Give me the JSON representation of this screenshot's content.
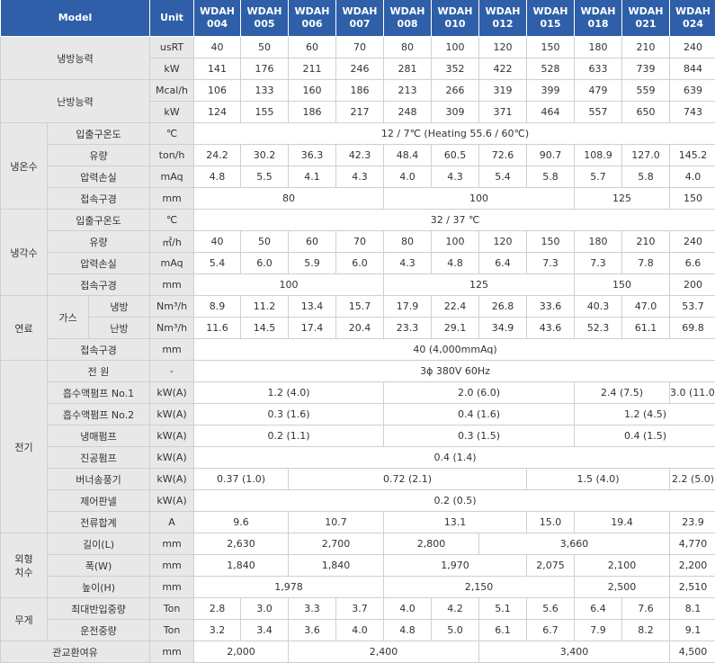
{
  "header": {
    "model": "Model",
    "unit": "Unit",
    "models": [
      {
        "name": "WDAH",
        "num": "004"
      },
      {
        "name": "WDAH",
        "num": "005"
      },
      {
        "name": "WDAH",
        "num": "006"
      },
      {
        "name": "WDAH",
        "num": "007"
      },
      {
        "name": "WDAH",
        "num": "008"
      },
      {
        "name": "WDAH",
        "num": "010"
      },
      {
        "name": "WDAH",
        "num": "012"
      },
      {
        "name": "WDAH",
        "num": "015"
      },
      {
        "name": "WDAH",
        "num": "018"
      },
      {
        "name": "WDAH",
        "num": "021"
      },
      {
        "name": "WDAH",
        "num": "024"
      }
    ]
  },
  "cooling": {
    "label": "냉방능력",
    "r1": {
      "unit": "usRT",
      "v": [
        "40",
        "50",
        "60",
        "70",
        "80",
        "100",
        "120",
        "150",
        "180",
        "210",
        "240"
      ]
    },
    "r2": {
      "unit": "kW",
      "v": [
        "141",
        "176",
        "211",
        "246",
        "281",
        "352",
        "422",
        "528",
        "633",
        "739",
        "844"
      ]
    }
  },
  "heating": {
    "label": "난방능력",
    "r1": {
      "unit": "Mcal/h",
      "v": [
        "106",
        "133",
        "160",
        "186",
        "213",
        "266",
        "319",
        "399",
        "479",
        "559",
        "639"
      ]
    },
    "r2": {
      "unit": "kW",
      "v": [
        "124",
        "155",
        "186",
        "217",
        "248",
        "309",
        "371",
        "464",
        "557",
        "650",
        "743"
      ]
    }
  },
  "chilled": {
    "label": "냉온수",
    "temp": {
      "label": "입출구온도",
      "unit": "℃",
      "value": "12 / 7℃  (Heating 55.6 / 60℃)"
    },
    "flow": {
      "label": "유량",
      "unit": "ton/h",
      "v": [
        "24.2",
        "30.2",
        "36.3",
        "42.3",
        "48.4",
        "60.5",
        "72.6",
        "90.7",
        "108.9",
        "127.0",
        "145.2"
      ]
    },
    "loss": {
      "label": "압력손실",
      "unit": "mAq",
      "v": [
        "4.8",
        "5.5",
        "4.1",
        "4.3",
        "4.0",
        "4.3",
        "5.4",
        "5.8",
        "5.7",
        "5.8",
        "4.0"
      ]
    },
    "pipe": {
      "label": "접속구경",
      "unit": "mm",
      "v": [
        "80",
        "100",
        "125",
        "150"
      ]
    }
  },
  "coolingwater": {
    "label": "냉각수",
    "temp": {
      "label": "입출구온도",
      "unit": "℃",
      "value": "32 / 37 ℃"
    },
    "flow": {
      "label": "유량",
      "unit": "㎥/h",
      "v": [
        "40",
        "50",
        "60",
        "70",
        "80",
        "100",
        "120",
        "150",
        "180",
        "210",
        "240"
      ]
    },
    "loss": {
      "label": "압력손실",
      "unit": "mAq",
      "v": [
        "5.4",
        "6.0",
        "5.9",
        "6.0",
        "4.3",
        "4.8",
        "6.4",
        "7.3",
        "7.3",
        "7.8",
        "6.6"
      ]
    },
    "pipe": {
      "label": "접속구경",
      "unit": "mm",
      "v": [
        "100",
        "125",
        "150",
        "200"
      ]
    }
  },
  "fuel": {
    "label": "연료",
    "gas": "가스",
    "cool": {
      "label": "냉방",
      "unit": "Nm³/h",
      "v": [
        "8.9",
        "11.2",
        "13.4",
        "15.7",
        "17.9",
        "22.4",
        "26.8",
        "33.6",
        "40.3",
        "47.0",
        "53.7"
      ]
    },
    "heat": {
      "label": "난방",
      "unit": "Nm³/h",
      "v": [
        "11.6",
        "14.5",
        "17.4",
        "20.4",
        "23.3",
        "29.1",
        "34.9",
        "43.6",
        "52.3",
        "61.1",
        "69.8"
      ]
    },
    "pipe": {
      "label": "접속구경",
      "unit": "mm",
      "value": "40 (4,000mmAq)"
    }
  },
  "electric": {
    "label": "전기",
    "power": {
      "label": "전 원",
      "unit": "-",
      "value": "3ϕ 380V 60Hz"
    },
    "pump1": {
      "label": "흡수액펌프 No.1",
      "unit": "kW(A)",
      "v": [
        "1.2 (4.0)",
        "2.0 (6.0)",
        "2.4 (7.5)",
        "3.0 (11.0)"
      ]
    },
    "pump2": {
      "label": "흡수액펌프 No.2",
      "unit": "kW(A)",
      "v": [
        "0.3 (1.6)",
        "0.4 (1.6)",
        "1.2 (4.5)"
      ]
    },
    "refpump": {
      "label": "냉매펌프",
      "unit": "kW(A)",
      "v": [
        "0.2 (1.1)",
        "0.3 (1.5)",
        "0.4 (1.5)"
      ]
    },
    "vacpump": {
      "label": "진공펌프",
      "unit": "kW(A)",
      "value": "0.4 (1.4)"
    },
    "burner": {
      "label": "버너송풍기",
      "unit": "kW(A)",
      "v": [
        "0.37 (1.0)",
        "0.72 (2.1)",
        "1.5 (4.0)",
        "2.2 (5.0)"
      ]
    },
    "panel": {
      "label": "제어판넬",
      "unit": "kW(A)",
      "value": "0.2 (0.5)"
    },
    "total": {
      "label": "전류합계",
      "unit": "A",
      "v": [
        "9.6",
        "10.7",
        "13.1",
        "15.0",
        "19.4",
        "23.9"
      ]
    }
  },
  "dimension": {
    "label1": "외형",
    "label2": "치수",
    "length": {
      "label": "길이(L)",
      "unit": "mm",
      "v": [
        "2,630",
        "2,700",
        "2,800",
        "3,660",
        "4,770"
      ]
    },
    "width": {
      "label": "폭(W)",
      "unit": "mm",
      "v": [
        "1,840",
        "1,840",
        "1,970",
        "2,075",
        "2,100",
        "2,200"
      ]
    },
    "height": {
      "label": "높이(H)",
      "unit": "mm",
      "v": [
        "1,978",
        "2,150",
        "2,500",
        "2,510"
      ]
    }
  },
  "weight": {
    "label": "무게",
    "max": {
      "label": "최대반입중량",
      "unit": "Ton",
      "v": [
        "2.8",
        "3.0",
        "3.3",
        "3.7",
        "4.0",
        "4.2",
        "5.1",
        "5.6",
        "6.4",
        "7.6",
        "8.1"
      ]
    },
    "op": {
      "label": "운전중량",
      "unit": "Ton",
      "v": [
        "3.2",
        "3.4",
        "3.6",
        "4.0",
        "4.8",
        "5.0",
        "6.1",
        "6.7",
        "7.9",
        "8.2",
        "9.1"
      ]
    }
  },
  "tube": {
    "label": "관교환여유",
    "unit": "mm",
    "v": [
      "2,000",
      "2,400",
      "3,400",
      "4,500"
    ]
  }
}
